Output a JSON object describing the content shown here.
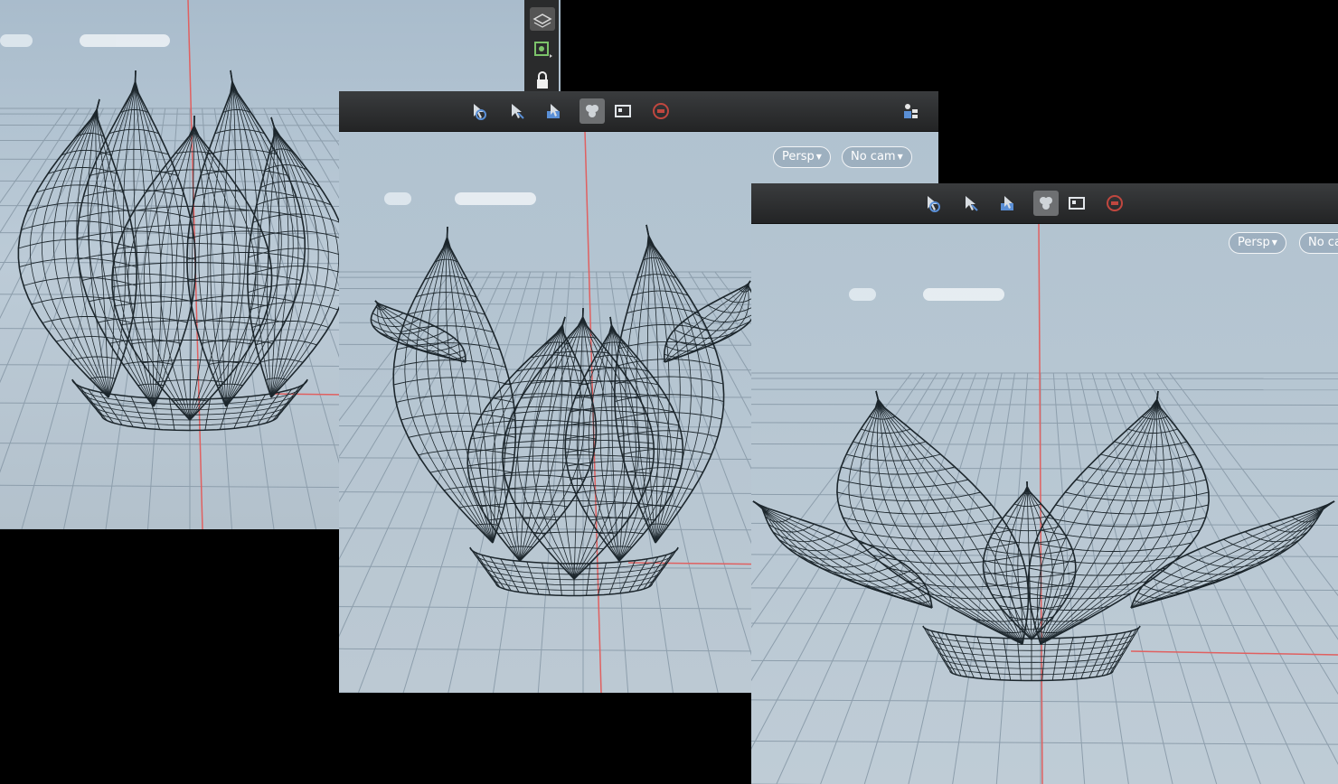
{
  "colors": {
    "background": "#000000",
    "viewport": "#b9c8d4",
    "grid": "#8fa0ad",
    "axis": "#e05050",
    "wire": "#1f2a30",
    "toolbar": "#2d2e30"
  },
  "panels": [
    {
      "name": "viewport-closed-bud",
      "toolbar_icons": [
        "lock-icon"
      ]
    },
    {
      "name": "viewport-opening-tulip",
      "view_mode": "Persp",
      "camera": "No cam",
      "toolbar_icons": [
        "select-transform-icon",
        "select-icon",
        "rotate-icon",
        "snap-icon",
        "display-icon",
        "stop-icon",
        "layer-icon"
      ]
    },
    {
      "name": "viewport-open-flower",
      "view_mode": "Persp",
      "camera": "No ca",
      "toolbar_icons": [
        "select-transform-icon",
        "select-icon",
        "rotate-icon",
        "snap-icon",
        "display-icon",
        "stop-icon"
      ]
    }
  ]
}
